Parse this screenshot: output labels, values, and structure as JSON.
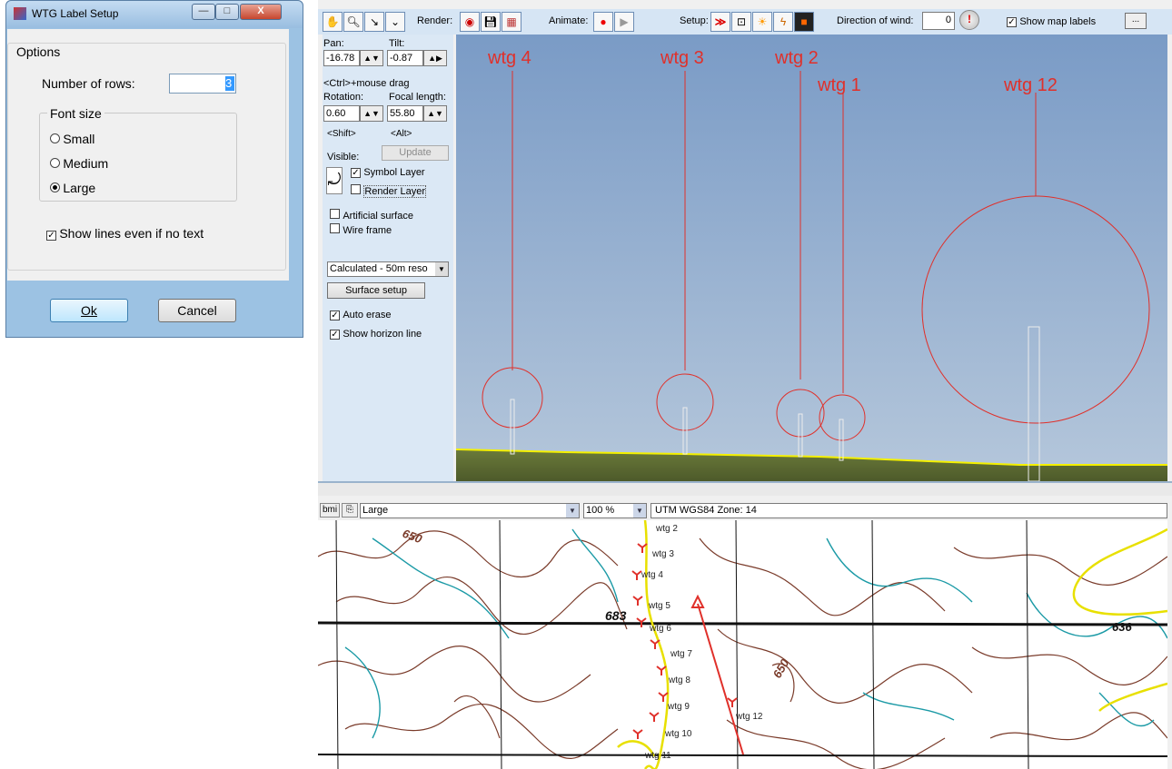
{
  "dialog": {
    "title": "WTG Label Setup",
    "minimize": "—",
    "maximize": "□",
    "close": "X",
    "options_group": "Options",
    "rows_label": "Number of rows:",
    "rows_value": "3",
    "font_group": "Font size",
    "font_options": [
      {
        "label": "Small",
        "selected": false
      },
      {
        "label": "Medium",
        "selected": false
      },
      {
        "label": "Large",
        "selected": true
      }
    ],
    "show_lines_label": "Show lines even if no text",
    "show_lines_checked": true,
    "ok_label": "Ok",
    "cancel_label": "Cancel"
  },
  "toolbar": {
    "render_label": "Render:",
    "animate_label": "Animate:",
    "setup_label": "Setup:",
    "wind_label": "Direction of wind:",
    "wind_value": "0",
    "show_map_labels": "Show map labels",
    "show_map_labels_checked": true,
    "more_btn": "..."
  },
  "controls": {
    "pan_label": "Pan:",
    "pan_value": "-16.78",
    "tilt_label": "Tilt:",
    "tilt_value": "-0.87",
    "ctrl_hint": "<Ctrl>+mouse drag",
    "rotation_label": "Rotation:",
    "rotation_value": "0.60",
    "focal_label": "Focal length:",
    "focal_value": "55.80",
    "shift_hint": "<Shift>",
    "alt_hint": "<Alt>",
    "update_label": "Update",
    "visible_label": "Visible:",
    "symbol_layer": "Symbol Layer",
    "render_layer": "Render Layer",
    "artificial_surface": "Artificial surface",
    "wire_frame": "Wire frame",
    "surface_combo": "Calculated - 50m reso",
    "surface_setup": "Surface setup",
    "auto_erase": "Auto erase",
    "show_horizon": "Show horizon line"
  },
  "scene_labels": [
    "wtg 4",
    "wtg 3",
    "wtg 2",
    "wtg 1",
    "wtg 12"
  ],
  "map": {
    "bmi_label": "bmi",
    "size_value": "Large",
    "zoom_value": "100 %",
    "coord_system": "UTM WGS84 Zone: 14",
    "turbine_labels": [
      "wtg 2",
      "wtg 3",
      "wtg 4",
      "wtg 5",
      "wtg 6",
      "wtg 7",
      "wtg 8",
      "wtg 9",
      "wtg 10",
      "wtg 11",
      "wtg 12"
    ],
    "elevations": [
      "650",
      "683",
      "650",
      "636"
    ]
  },
  "colors": {
    "label_red": "#e0302a",
    "horizon_yellow": "#f4f000",
    "sky_top": "#7a9bc6",
    "sky_bottom": "#b5c7db",
    "contour_brown": "#7a3b2a",
    "water_teal": "#1b9aa6"
  }
}
